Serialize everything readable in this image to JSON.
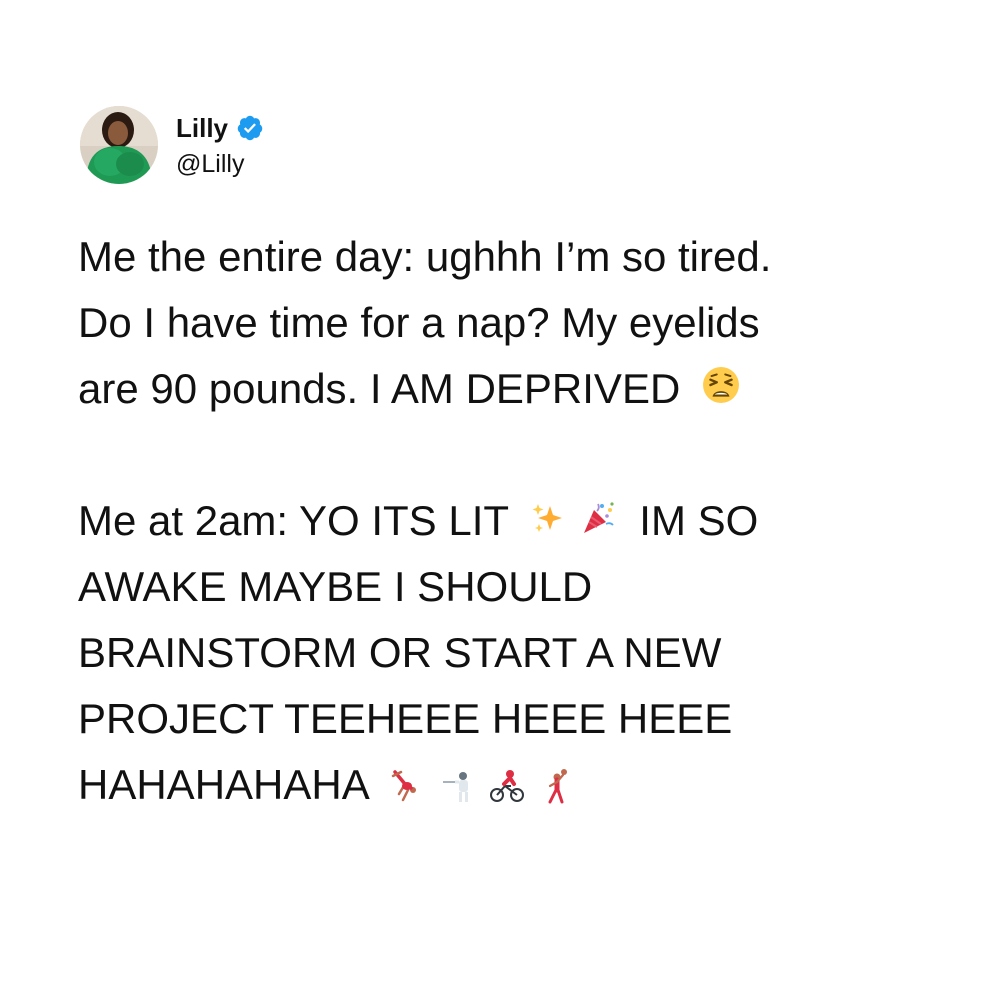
{
  "tweet": {
    "author": {
      "display_name": "Lilly",
      "handle": "@Lilly",
      "verified": true,
      "verified_badge_color": "#1d9bf0"
    },
    "paragraph1": {
      "lines": [
        "Me the entire day: ughhh I’m so tired.",
        "Do I have time for a nap? My eyelids",
        "are 90 pounds. I AM DEPRIVED"
      ],
      "trailing_emoji": "tired-face-emoji"
    },
    "paragraph2": {
      "line1_before": "Me at 2am: YO ITS LIT",
      "line1_emojis": [
        "sparkles-emoji",
        "party-popper-emoji"
      ],
      "line1_after": "IM SO",
      "lines": [
        "AWAKE MAYBE I SHOULD",
        "BRAINSTORM OR START A NEW",
        "PROJECT TEEHEEE HEEE HEEE"
      ],
      "last_line_text": "HAHAHAHAHA",
      "last_line_emojis": [
        "person-cartwheeling-emoji",
        "person-fencing-emoji",
        "person-biking-emoji",
        "person-playing-handball-emoji"
      ]
    }
  }
}
